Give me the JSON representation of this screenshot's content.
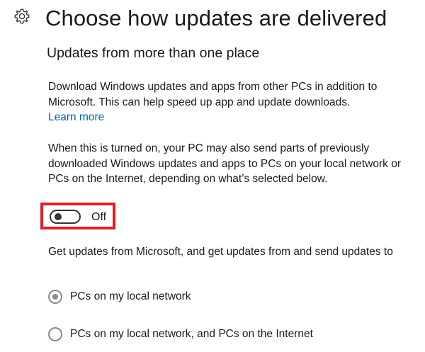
{
  "header": {
    "icon": "gear-icon",
    "title": "Choose how updates are delivered"
  },
  "section": {
    "title": "Updates from more than one place"
  },
  "description": {
    "text": "Download Windows updates and apps from other PCs in addition to Microsoft. This can help speed up app and update downloads.",
    "link_label": "Learn more"
  },
  "note": {
    "text": "When this is turned on, your PC may also send parts of previously downloaded Windows updates and apps to PCs on your local network or PCs on the Internet, depending on what’s selected below."
  },
  "toggle": {
    "state_label": "Off",
    "on": false
  },
  "source_options": {
    "prompt": "Get updates from Microsoft, and get updates from and send updates to",
    "options": [
      {
        "label": "PCs on my local network",
        "selected": true
      },
      {
        "label": "PCs on my local network, and PCs on the Internet",
        "selected": false
      }
    ]
  },
  "colors": {
    "link": "#0063b1",
    "highlight_border": "#e01e26",
    "text": "#1a1a1a",
    "radio_disabled": "#8a8a8a"
  }
}
